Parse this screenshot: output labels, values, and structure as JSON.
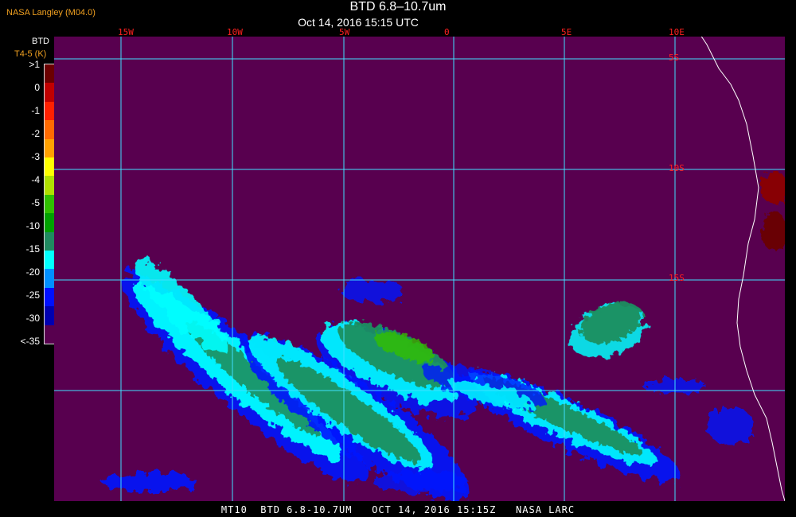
{
  "header": {
    "title": "BTD 6.8–10.7um",
    "datetime": "Oct 14, 2016 15:15 UTC",
    "agency": "NASA Langley (M04.0)"
  },
  "colorbar": {
    "title": "BTD",
    "subtitle": "T4-5 (K)",
    "labels": [
      ">1",
      "0",
      "-1",
      "-2",
      "-3",
      "-4",
      "-5",
      "-10",
      "-15",
      "-20",
      "-25",
      "-30",
      "<-35"
    ],
    "colors": [
      "#6b0000",
      "#c00000",
      "#ff2000",
      "#ff6a00",
      "#ffa000",
      "#ffff00",
      "#b0e000",
      "#30c000",
      "#00a000",
      "#208a60",
      "#00ffff",
      "#0090ff",
      "#0010ff",
      "#0000b0",
      "#58004f"
    ]
  },
  "map": {
    "background": "#58004f",
    "grid_color": "#40e0ff",
    "lon_labels": [
      "15W",
      "10W",
      "5W",
      "0",
      "5E",
      "10E"
    ],
    "lat_labels": [
      "5S",
      "10S",
      "15S"
    ]
  },
  "footer": "MT10  BTD 6.8-10.7UM   OCT 14, 2016 15:15Z   NASA LARC"
}
